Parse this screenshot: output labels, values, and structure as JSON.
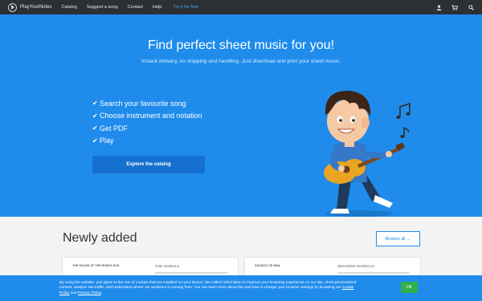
{
  "nav": {
    "brand": "PlayYourNotes",
    "links": [
      "Catalog",
      "Suggest a song",
      "Contact",
      "Help"
    ],
    "cta": "Try it for free",
    "icons": [
      "user-icon",
      "cart-icon",
      "search-icon"
    ]
  },
  "hero": {
    "title": "Find perfect sheet music for you!",
    "subtitle": "Instant delivery, no shipping and handling. Just download and print your sheet music.",
    "features": [
      "Search your favourite song",
      "Choose instrument and notation",
      "Get PDF",
      "Play"
    ],
    "button": "Explore the catalog"
  },
  "newly_added": {
    "title": "Newly added",
    "browse": "Browse all →",
    "cards": [
      {
        "thumb_title": "THE HOUSE OF THE RISING SUN",
        "artist": "The Animals"
      },
      {
        "thumb_title": "ZATAŃCZ ZE MNĄ",
        "artist": "Zbigniew Wodecki"
      }
    ]
  },
  "cookie": {
    "text_before": "By using the website, you agree to the use of cookies that are installed on your device. We collect information to improve your browsing experience on our site, show personalized content, analyze site traffic, and understand where our audience is coming from. You can learn more about this and how to change your browser settings by browsing our ",
    "policy_link": "Cookie Policy",
    "and": " and ",
    "privacy_link": "Privacy Policy",
    "period": ".",
    "ok": "OK"
  },
  "colors": {
    "nav_bg": "#2c2f33",
    "hero_bg": "#1f8ceb",
    "button_bg": "#1670cf",
    "ok_green": "#2fb24a"
  }
}
